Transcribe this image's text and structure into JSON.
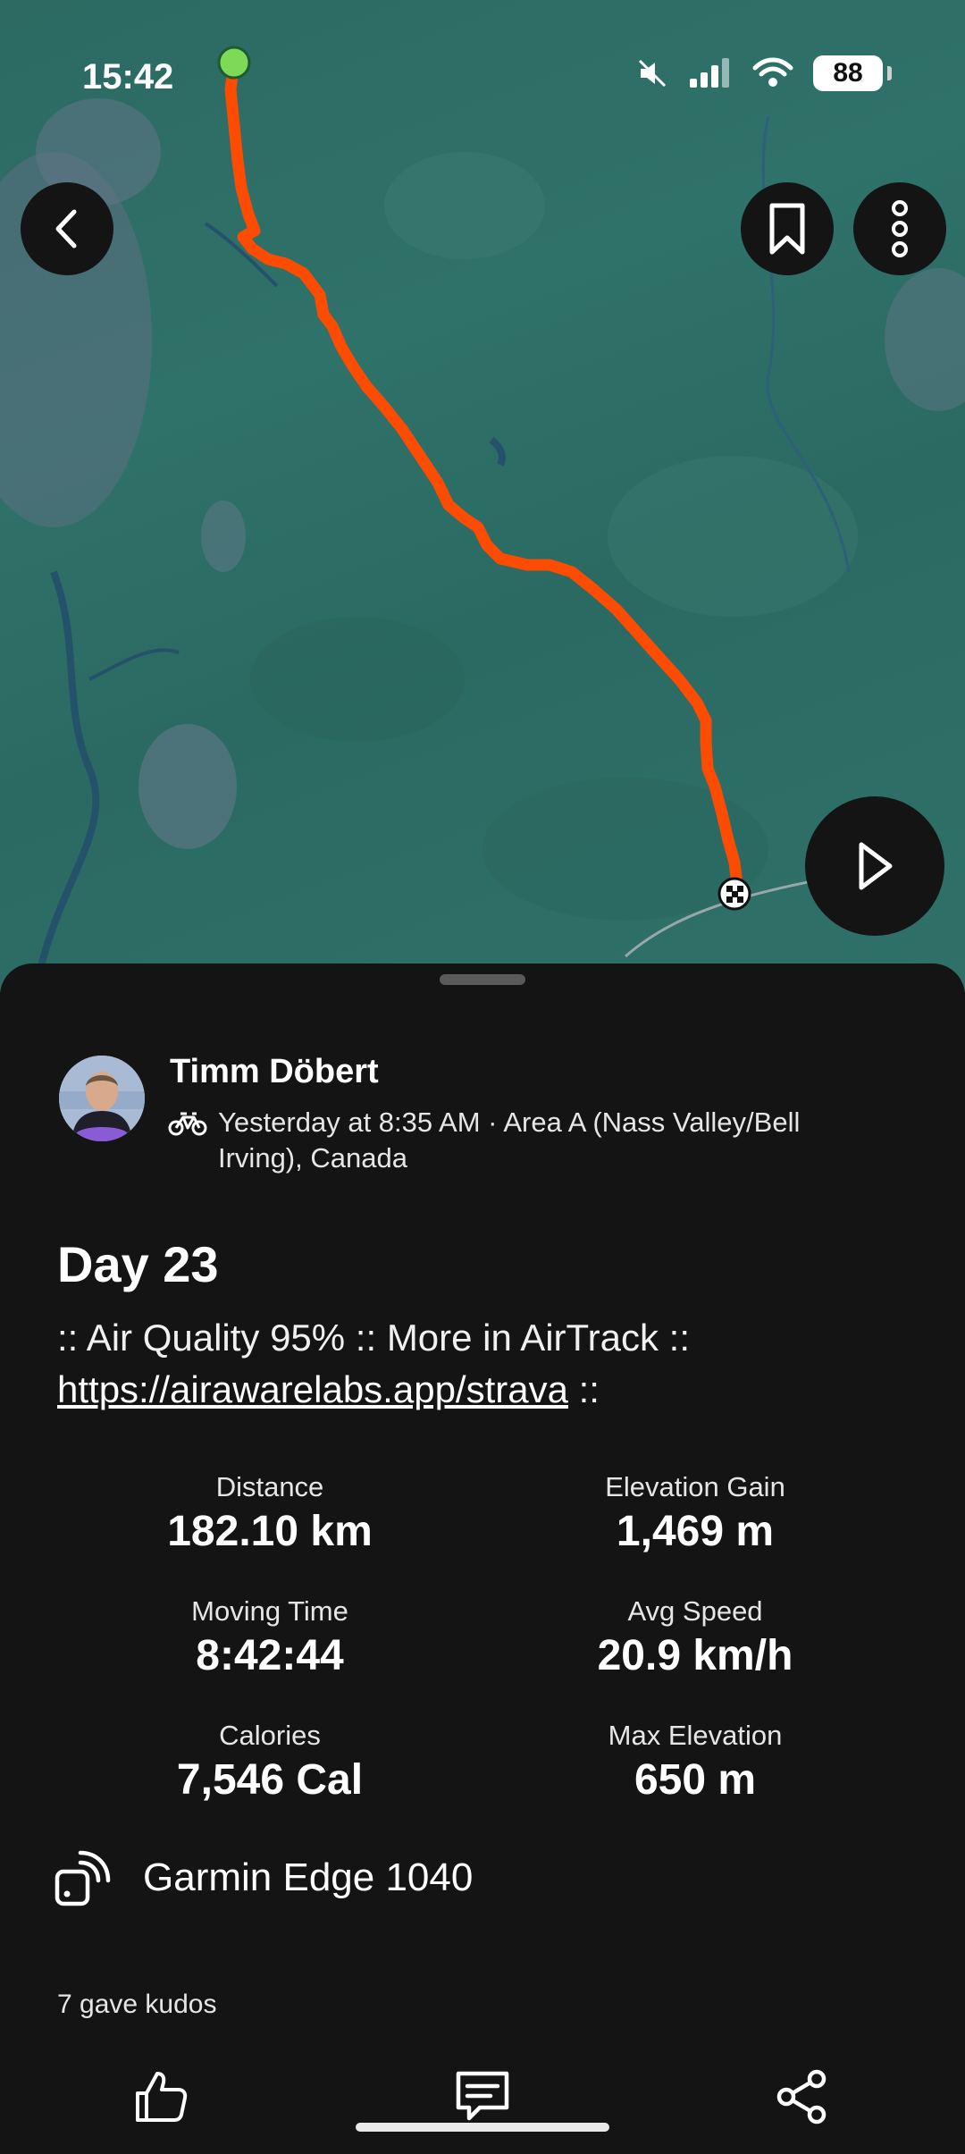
{
  "status_bar": {
    "time": "15:42",
    "battery": "88"
  },
  "activity": {
    "athlete_name": "Timm Döbert",
    "meta": "Yesterday at 8:35 AM · Area A (Nass Valley/Bell Irving), Canada",
    "title": "Day 23",
    "description_prefix": ":: Air Quality 95% :: More in AirTrack ::",
    "description_link": "https://airawarelabs.app/strava",
    "description_suffix": " ::",
    "stats": [
      {
        "label": "Distance",
        "value": "182.10 km"
      },
      {
        "label": "Elevation Gain",
        "value": "1,469 m"
      },
      {
        "label": "Moving Time",
        "value": "8:42:44"
      },
      {
        "label": "Avg Speed",
        "value": "20.9 km/h"
      },
      {
        "label": "Calories",
        "value": "7,546 Cal"
      },
      {
        "label": "Max Elevation",
        "value": "650 m"
      }
    ],
    "device": "Garmin Edge 1040",
    "kudos": "7 gave kudos"
  },
  "icons": {
    "back": "chevron-left-icon",
    "bookmark": "bookmark-icon",
    "more": "more-vertical-icon",
    "play": "play-icon",
    "kudos": "thumbs-up-icon",
    "comment": "comment-icon",
    "share": "share-icon"
  },
  "colors": {
    "route": "#fc4c02",
    "start": "#7ed957",
    "sheet": "#141414",
    "map": "#2f7169"
  }
}
